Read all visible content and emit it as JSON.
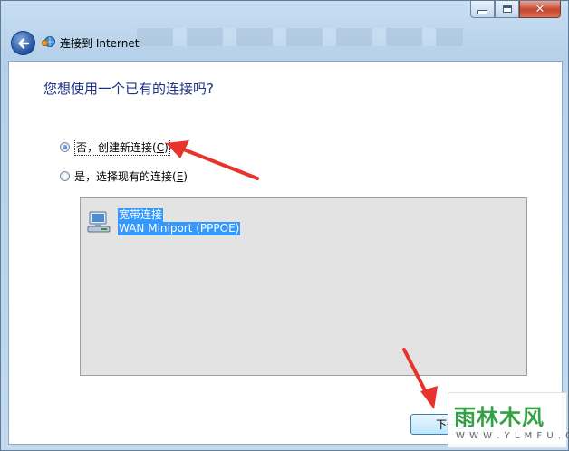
{
  "window": {
    "title": "连接到 Internet",
    "caption_buttons": {
      "minimize": "minimize-icon",
      "maximize": "maximize-icon",
      "close": "close-icon"
    }
  },
  "main": {
    "heading": "您想使用一个已有的连接吗?",
    "options": [
      {
        "label": "否，创建新连接(",
        "mnemonic": "C",
        "suffix": ")",
        "selected": true
      },
      {
        "label": "是，选择现有的连接(",
        "mnemonic": "E",
        "suffix": ")",
        "selected": false
      }
    ],
    "connections": [
      {
        "name": "宽带连接",
        "device": "WAN Miniport (PPPOE)",
        "icon": "network-connection-icon",
        "selected": true
      }
    ]
  },
  "footer": {
    "next_label": "下一步"
  },
  "watermark": {
    "title": "雨林木风",
    "url": "W W W . Y L M F U . C O M"
  },
  "colors": {
    "accent_arrow": "#e8332d",
    "selection": "#3399ff",
    "heading": "#1e3287"
  }
}
